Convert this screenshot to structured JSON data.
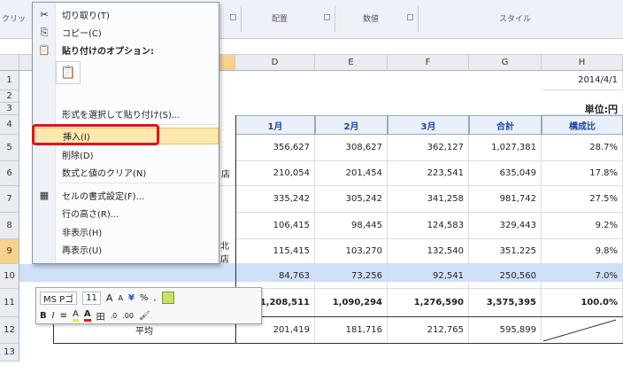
{
  "ribbon": {
    "partial_left": "クリッ",
    "groups": [
      "配置",
      "数値",
      "スタイル"
    ]
  },
  "columns": {
    "D": "D",
    "E": "E",
    "F": "F",
    "G": "G",
    "H": "H"
  },
  "rows": [
    "1",
    "2",
    "3",
    "4",
    "5",
    "6",
    "7",
    "8",
    "9",
    "10",
    "11",
    "12",
    "13"
  ],
  "sheet": {
    "date": "2014/4/1",
    "unit": "単位:円",
    "headers": [
      "1月",
      "2月",
      "3月",
      "合計",
      "構成比"
    ],
    "partial_cell_row6": "店",
    "partial_cell_row9": "北店",
    "data": [
      [
        "356,627",
        "308,627",
        "362,127",
        "1,027,381",
        "28.7%"
      ],
      [
        "210,054",
        "201,454",
        "223,541",
        "635,049",
        "17.8%"
      ],
      [
        "335,242",
        "305,242",
        "341,258",
        "981,742",
        "27.5%"
      ],
      [
        "106,415",
        "98,445",
        "124,583",
        "329,443",
        "9.2%"
      ],
      [
        "115,415",
        "103,270",
        "132,540",
        "351,225",
        "9.8%"
      ],
      [
        "84,763",
        "73,256",
        "92,541",
        "250,560",
        "7.0%"
      ],
      [
        "1,208,511",
        "1,090,294",
        "1,276,590",
        "3,575,395",
        "100.0%"
      ]
    ],
    "avg_label": "平均",
    "avg": [
      "201,419",
      "181,716",
      "212,765",
      "595,899"
    ]
  },
  "context_menu": {
    "items": [
      {
        "label": "切り取り(T)",
        "icon": "scissors-icon",
        "glyph": "✂"
      },
      {
        "label": "コピー(C)",
        "icon": "copy-icon",
        "glyph": "⎘"
      },
      {
        "label": "貼り付けのオプション:",
        "icon": "paste-icon",
        "glyph": "📋"
      },
      {
        "label": "形式を選択して貼り付け(S)...",
        "icon": "",
        "glyph": ""
      },
      {
        "label": "挿入(I)",
        "icon": "",
        "glyph": ""
      },
      {
        "label": "削除(D)",
        "icon": "",
        "glyph": ""
      },
      {
        "label": "数式と値のクリア(N)",
        "icon": "",
        "glyph": ""
      },
      {
        "label": "セルの書式設定(F)...",
        "icon": "format-cells-icon",
        "glyph": "▦"
      },
      {
        "label": "行の高さ(R)...",
        "icon": "",
        "glyph": ""
      },
      {
        "label": "非表示(H)",
        "icon": "",
        "glyph": ""
      },
      {
        "label": "再表示(U)",
        "icon": "",
        "glyph": ""
      }
    ],
    "paste_option_glyph": "📋"
  },
  "mini_toolbar": {
    "font_name": "MS Pゴ",
    "font_size": "11",
    "grow": "A",
    "shrink": "A",
    "currency": "¥",
    "percent": "%",
    "comma": ",",
    "bold": "B",
    "italic": "I",
    "align": "≡",
    "fill": "A",
    "font_color": "A",
    "border": "田",
    "dec_inc": ".0",
    "dec_dec": ".00",
    "brush": "🖌"
  },
  "colors": {
    "highlight_outline": "#e0141a",
    "selected_row": "#cfe0f8",
    "header_text": "#1a47a8"
  }
}
